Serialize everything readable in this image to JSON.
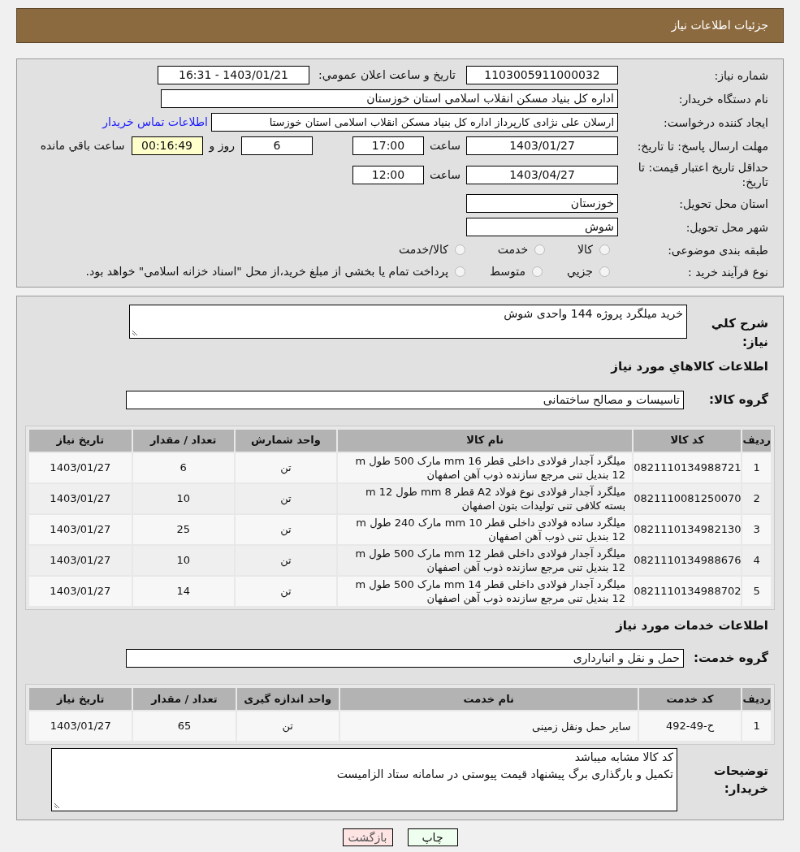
{
  "header": {
    "title": "جزئیات اطلاعات نیاز"
  },
  "details": {
    "need_number": {
      "label": "شماره نیاز:",
      "value": "1103005911000032"
    },
    "announce": {
      "label": "تاریخ و ساعت اعلان عمومي:",
      "value": "1403/01/21 - 16:31"
    },
    "buyer": {
      "label": "نام دستگاه خریدار:",
      "value": "اداره کل بنیاد مسکن انقلاب اسلامی استان خوزستان"
    },
    "creator": {
      "label": "ایجاد کننده درخواست:",
      "value": "ارسلان علی نژادی کارپرداز اداره کل بنیاد مسکن انقلاب اسلامی استان خوزستا",
      "link": "اطلاعات تماس خریدار"
    },
    "deadline": {
      "label": "مهلت ارسال پاسخ: تا تاریخ:",
      "date": "1403/01/27",
      "time_label": "ساعت",
      "time": "17:00",
      "days": "6",
      "days_label": "روز و",
      "remaining": "00:16:49",
      "remaining_label": "ساعت باقي مانده"
    },
    "validity": {
      "label": "حداقل تاریخ اعتبار قیمت: تا تاریخ:",
      "date": "1403/04/27",
      "time_label": "ساعت",
      "time": "12:00"
    },
    "province": {
      "label": "استان محل تحویل:",
      "value": "خوزستان"
    },
    "city": {
      "label": "شهر محل تحویل:",
      "value": "شوش"
    },
    "category": {
      "label": "طبقه بندی موضوعی:",
      "options": [
        {
          "label": "کالا",
          "selected": false
        },
        {
          "label": "خدمت",
          "selected": false
        },
        {
          "label": "کالا/خدمت",
          "selected": false
        }
      ]
    },
    "purchase_type": {
      "label": "نوع فرآیند خرید :",
      "options": [
        {
          "label": "جزيي",
          "selected": false
        },
        {
          "label": "متوسط",
          "selected": false
        },
        {
          "label": "پرداخت تمام یا بخشی از مبلغ خرید،از محل \"اسناد خزانه اسلامی\" خواهد بود.",
          "selected": false
        }
      ]
    }
  },
  "summary": {
    "label": "شرح کلي نیاز:",
    "value": "خرید میلگرد پروژه 144 واحدی شوش"
  },
  "goods": {
    "title": "اطلاعات کالاهاي مورد نياز",
    "group_label": "گروه کالا:",
    "group": "تاسیسات و مصالح ساختمانی",
    "columns": [
      "ردیف",
      "کد کالا",
      "نام کالا",
      "واحد شمارش",
      "تعداد / مقدار",
      "تاریخ نیاز"
    ],
    "rows": [
      [
        "1",
        "0821110134988721",
        "میلگرد آجدار فولادی داخلی قطر mm 16 مارک 500 طول m 12 بندیل تنی مرجع سازنده ذوب آهن اصفهان",
        "تن",
        "6",
        "1403/01/27"
      ],
      [
        "2",
        "0821110081250070",
        "میلگرد آجدار فولادی نوع فولاد A2 قطر mm 8 طول m 12 بسته کلافی تنی تولیدات بتون اصفهان",
        "تن",
        "10",
        "1403/01/27"
      ],
      [
        "3",
        "0821110134982130",
        "میلگرد ساده فولادی داخلی قطر mm 10 مارک 240 طول m 12 بندیل تنی ذوب آهن اصفهان",
        "تن",
        "25",
        "1403/01/27"
      ],
      [
        "4",
        "0821110134988676",
        "میلگرد آجدار فولادی داخلی قطر mm 12 مارک 500 طول m 12 بندیل تنی مرجع سازنده ذوب آهن اصفهان",
        "تن",
        "10",
        "1403/01/27"
      ],
      [
        "5",
        "0821110134988702",
        "میلگرد آجدار فولادی داخلی قطر mm 14 مارک 500 طول m 12 بندیل تنی مرجع سازنده ذوب آهن اصفهان",
        "تن",
        "14",
        "1403/01/27"
      ]
    ]
  },
  "services": {
    "title": "اطلاعات خدمات مورد نياز",
    "group_label": "گروه خدمت:",
    "group": "حمل و نقل و انبارداری",
    "columns": [
      "ردیف",
      "کد خدمت",
      "نام خدمت",
      "واحد اندازه گیری",
      "تعداد / مقدار",
      "تاریخ نیاز"
    ],
    "rows": [
      [
        "1",
        "ح-49-492",
        "سایر حمل ونقل زمینی",
        "تن",
        "65",
        "1403/01/27"
      ]
    ]
  },
  "buyer_notes": {
    "label": "توضیحات خریدار:",
    "lines": [
      "کد کالا مشابه میباشد",
      "تکمیل و بارگذاری برگ پیشنهاد قیمت پیوستی در سامانه ستاد الزامیست"
    ]
  },
  "buttons": [
    {
      "label": "چاپ",
      "kind": "print"
    },
    {
      "label": "بازگشت",
      "kind": "back"
    }
  ]
}
